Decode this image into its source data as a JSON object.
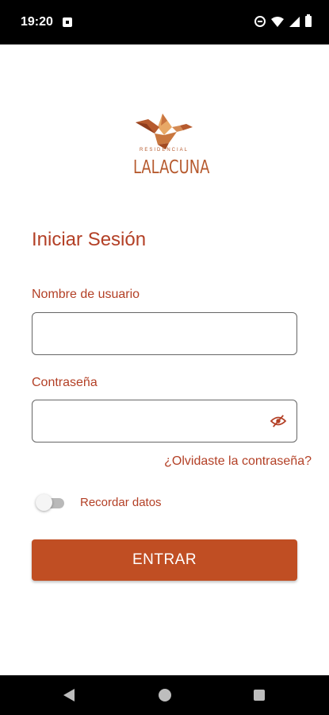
{
  "status_bar": {
    "time": "19:20",
    "icons": [
      "notification-icon",
      "do-not-disturb-icon",
      "wifi-icon",
      "signal-icon",
      "battery-icon"
    ]
  },
  "logo": {
    "small_text": "RESIDENCIAL",
    "name": "LALACUNA",
    "colors": {
      "primary": "#b65a2e",
      "accent": "#e8a866"
    }
  },
  "form": {
    "title": "Iniciar Sesión",
    "username": {
      "label": "Nombre de usuario",
      "value": "",
      "placeholder": ""
    },
    "password": {
      "label": "Contraseña",
      "value": "",
      "placeholder": "",
      "toggle_icon": "visibility-off-icon"
    },
    "forgot_password": "¿Olvidaste la contraseña?",
    "remember": {
      "label": "Recordar datos",
      "checked": false
    },
    "submit_label": "ENTRAR"
  },
  "theme": {
    "accent": "#b34026",
    "button": "#c04e23",
    "input_border": "#666666"
  },
  "nav_bar": {
    "icons": [
      "back-icon",
      "home-icon",
      "recents-icon"
    ]
  }
}
